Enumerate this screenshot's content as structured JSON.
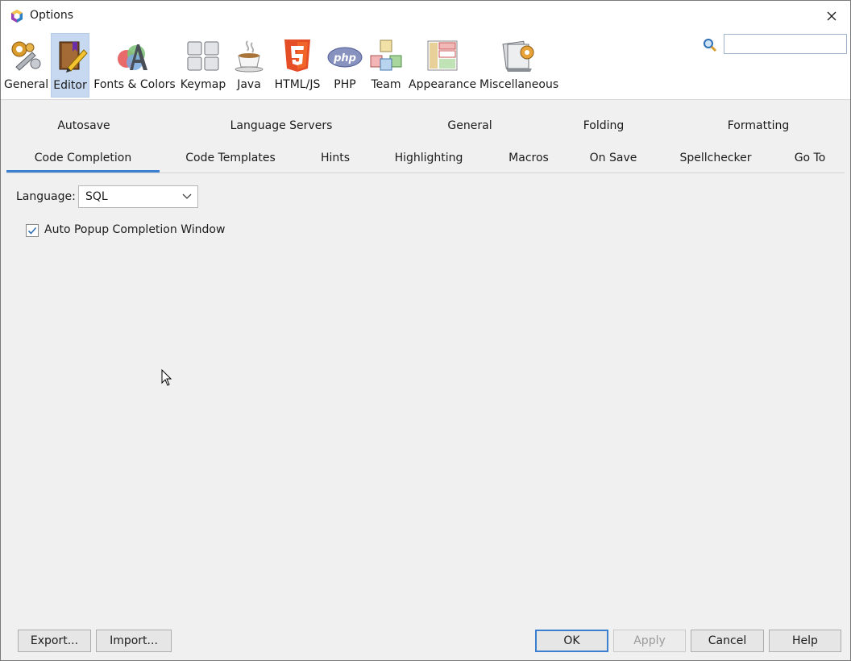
{
  "window": {
    "title": "Options"
  },
  "categories": [
    {
      "label": "General",
      "icon": "wrench-gears-icon"
    },
    {
      "label": "Editor",
      "icon": "editor-book-icon",
      "selected": true
    },
    {
      "label": "Fonts & Colors",
      "icon": "fonts-colors-icon"
    },
    {
      "label": "Keymap",
      "icon": "keyboard-icon"
    },
    {
      "label": "Java",
      "icon": "java-cup-icon"
    },
    {
      "label": "HTML/JS",
      "icon": "html5-icon"
    },
    {
      "label": "PHP",
      "icon": "php-icon"
    },
    {
      "label": "Team",
      "icon": "team-cubes-icon"
    },
    {
      "label": "Appearance",
      "icon": "appearance-layout-icon"
    },
    {
      "label": "Miscellaneous",
      "icon": "miscellaneous-icon"
    }
  ],
  "search": {
    "value": "",
    "placeholder": ""
  },
  "tabs_row1": [
    "Autosave",
    "Language Servers",
    "General",
    "Folding",
    "Formatting"
  ],
  "tabs_row2": [
    "Code Completion",
    "Code Templates",
    "Hints",
    "Highlighting",
    "Macros",
    "On Save",
    "Spellchecker",
    "Go To"
  ],
  "active_tab": "Code Completion",
  "content": {
    "language_label": "Language:",
    "language_value": "SQL",
    "auto_popup_label": "Auto Popup Completion Window",
    "auto_popup_checked": true
  },
  "footer": {
    "export": "Export...",
    "import": "Import...",
    "ok": "OK",
    "apply": "Apply",
    "cancel": "Cancel",
    "help": "Help"
  },
  "colors": {
    "accent": "#3b7fd1",
    "selected_category": "#c6d9f1"
  }
}
